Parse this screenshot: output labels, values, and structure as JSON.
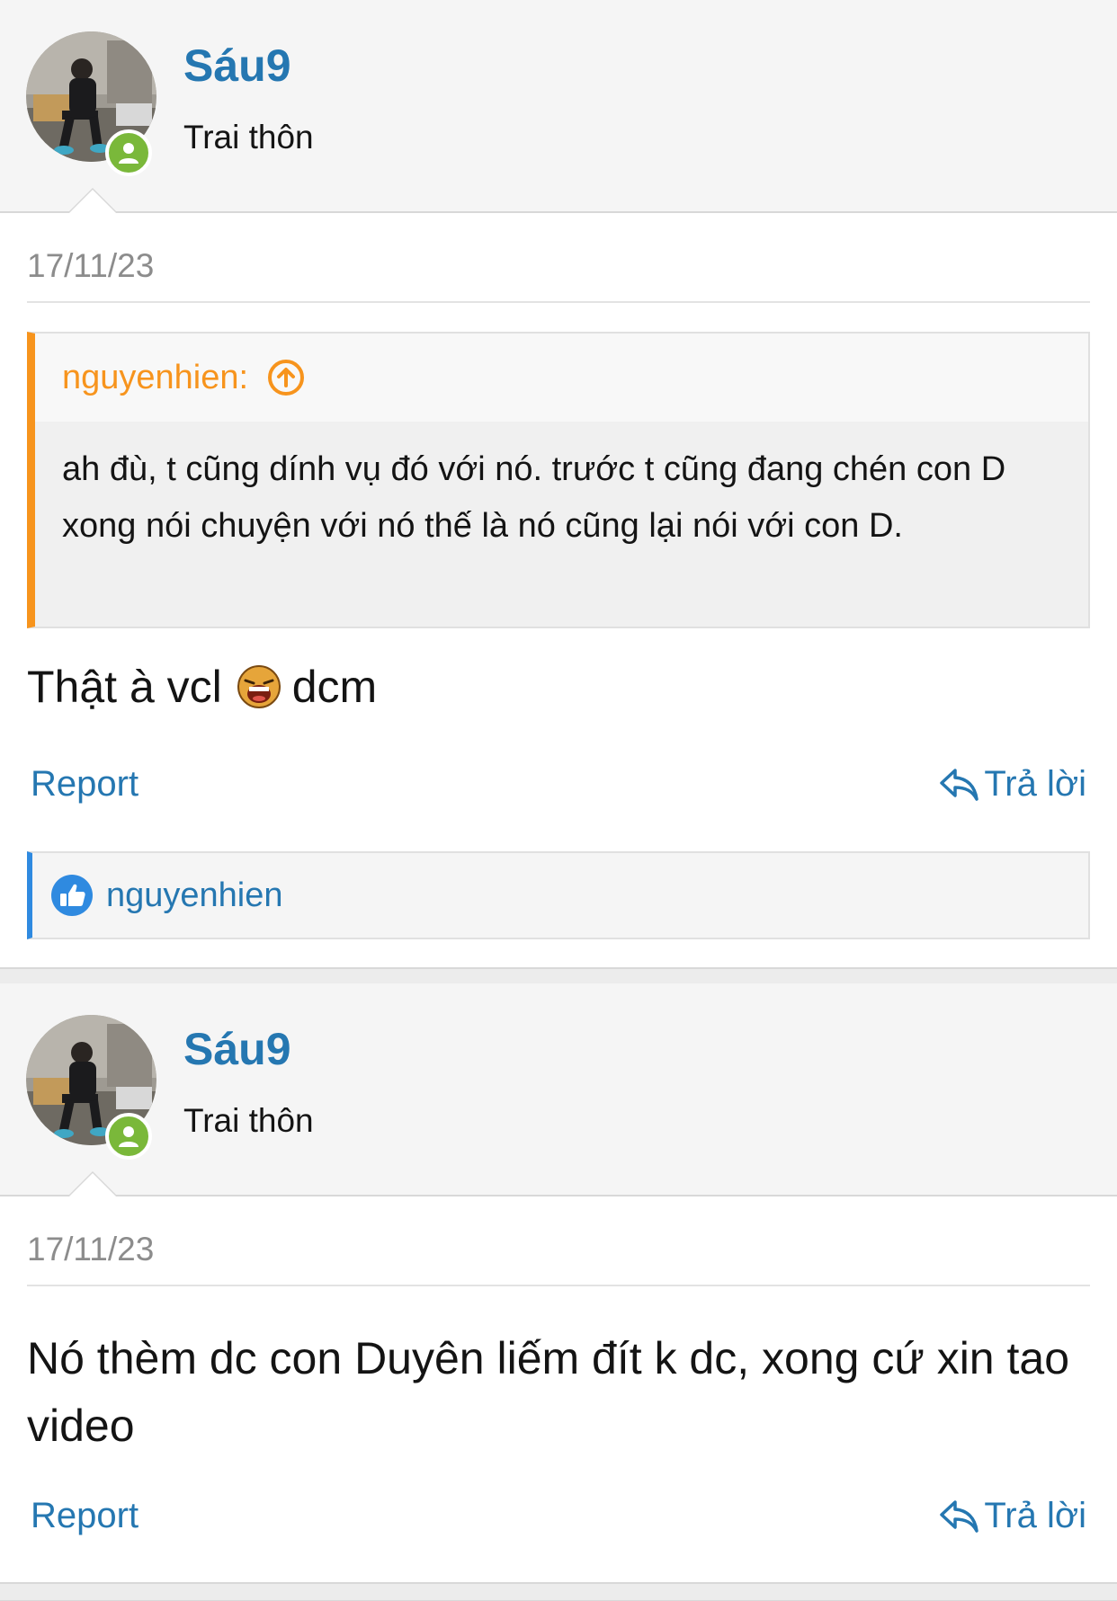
{
  "posts": [
    {
      "username": "Sáu9",
      "user_title": "Trai thôn",
      "date": "17/11/23",
      "quote": {
        "author": "nguyenhien:",
        "text": "ah đù, t cũng dính vụ đó với nó. trước t cũng đang chén con D xong nói chuyện với nó thế là nó cũng lại nói với con D."
      },
      "message_part1": "Thật à vcl",
      "message_emoji": "laughing-emoji",
      "message_part2": "dcm",
      "report_label": "Report",
      "reply_label": "Trả lời",
      "reaction_user": "nguyenhien"
    },
    {
      "username": "Sáu9",
      "user_title": "Trai thôn",
      "date": "17/11/23",
      "message": "Nó thèm dc con Duyên liếm đít k dc, xong cứ xin tao video",
      "report_label": "Report",
      "reply_label": "Trả lời"
    }
  ],
  "colors": {
    "username": "#2577b1",
    "quote_accent": "#f7941d",
    "reaction_accent": "#2f8ae0",
    "online": "#7ab83a"
  }
}
